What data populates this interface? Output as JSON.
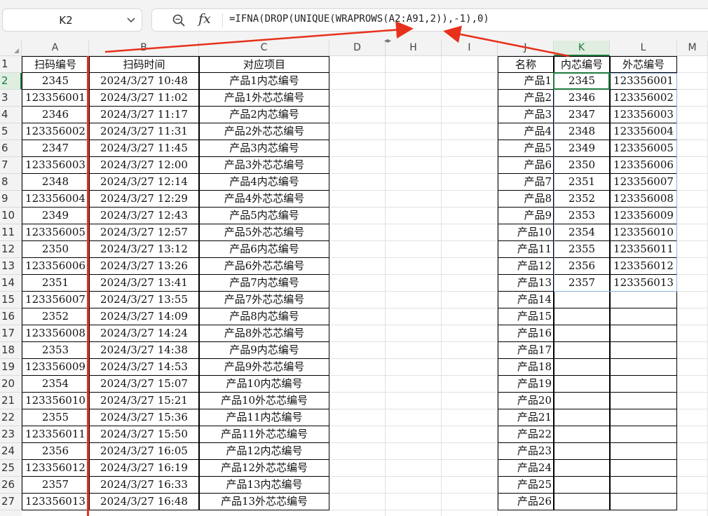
{
  "name_box": {
    "value": "K2"
  },
  "formula_bar": {
    "formula": "=IFNA(DROP(UNIQUE(WRAPROWS(A2:A91,2)),-1),0)",
    "fx_label": "fx"
  },
  "columns": [
    "A",
    "B",
    "C",
    "D",
    "H",
    "I",
    "J",
    "K",
    "L",
    "M"
  ],
  "selected_column": "K",
  "rows": [
    "1",
    "2",
    "3",
    "4",
    "5",
    "6",
    "7",
    "8",
    "9",
    "10",
    "11",
    "12",
    "13",
    "14",
    "15",
    "16",
    "17",
    "18",
    "19",
    "20",
    "21",
    "22",
    "23",
    "24",
    "25",
    "26",
    "27"
  ],
  "selected_row": "2",
  "left_table": {
    "headers": [
      "扫码编号",
      "扫码时间",
      "对应项目"
    ],
    "rows": [
      [
        "2345",
        "2024/3/27  10:48",
        "产品1内芯编号"
      ],
      [
        "123356001",
        "2024/3/27  11:02",
        "产品1外芯芯编号"
      ],
      [
        "2346",
        "2024/3/27  11:17",
        "产品2内芯编号"
      ],
      [
        "123356002",
        "2024/3/27  11:31",
        "产品2外芯芯编号"
      ],
      [
        "2347",
        "2024/3/27  11:45",
        "产品3内芯编号"
      ],
      [
        "123356003",
        "2024/3/27  12:00",
        "产品3外芯芯编号"
      ],
      [
        "2348",
        "2024/3/27  12:14",
        "产品4内芯编号"
      ],
      [
        "123356004",
        "2024/3/27  12:29",
        "产品4外芯芯编号"
      ],
      [
        "2349",
        "2024/3/27  12:43",
        "产品5内芯编号"
      ],
      [
        "123356005",
        "2024/3/27  12:57",
        "产品5外芯芯编号"
      ],
      [
        "2350",
        "2024/3/27  13:12",
        "产品6内芯编号"
      ],
      [
        "123356006",
        "2024/3/27  13:26",
        "产品6外芯芯编号"
      ],
      [
        "2351",
        "2024/3/27  13:41",
        "产品7内芯编号"
      ],
      [
        "123356007",
        "2024/3/27  13:55",
        "产品7外芯芯编号"
      ],
      [
        "2352",
        "2024/3/27  14:09",
        "产品8内芯编号"
      ],
      [
        "123356008",
        "2024/3/27  14:24",
        "产品8外芯芯编号"
      ],
      [
        "2353",
        "2024/3/27  14:38",
        "产品9内芯编号"
      ],
      [
        "123356009",
        "2024/3/27  14:53",
        "产品9外芯芯编号"
      ],
      [
        "2354",
        "2024/3/27  15:07",
        "产品10内芯编号"
      ],
      [
        "123356010",
        "2024/3/27  15:21",
        "产品10外芯芯编号"
      ],
      [
        "2355",
        "2024/3/27  15:36",
        "产品11内芯编号"
      ],
      [
        "123356011",
        "2024/3/27  15:50",
        "产品11外芯芯编号"
      ],
      [
        "2356",
        "2024/3/27  16:05",
        "产品12内芯编号"
      ],
      [
        "123356012",
        "2024/3/27  16:19",
        "产品12外芯芯编号"
      ],
      [
        "2357",
        "2024/3/27  16:33",
        "产品13内芯编号"
      ],
      [
        "123356013",
        "2024/3/27  16:48",
        "产品13外芯芯编号"
      ]
    ]
  },
  "right_table": {
    "headers": [
      "名称",
      "内芯编号",
      "外芯编号"
    ],
    "rows": [
      [
        "产品1",
        "2345",
        "123356001"
      ],
      [
        "产品2",
        "2346",
        "123356002"
      ],
      [
        "产品3",
        "2347",
        "123356003"
      ],
      [
        "产品4",
        "2348",
        "123356004"
      ],
      [
        "产品5",
        "2349",
        "123356005"
      ],
      [
        "产品6",
        "2350",
        "123356006"
      ],
      [
        "产品7",
        "2351",
        "123356007"
      ],
      [
        "产品8",
        "2352",
        "123356008"
      ],
      [
        "产品9",
        "2353",
        "123356009"
      ],
      [
        "产品10",
        "2354",
        "123356010"
      ],
      [
        "产品11",
        "2355",
        "123356011"
      ],
      [
        "产品12",
        "2356",
        "123356012"
      ],
      [
        "产品13",
        "2357",
        "123356013"
      ],
      [
        "产品14",
        "",
        ""
      ],
      [
        "产品15",
        "",
        ""
      ],
      [
        "产品16",
        "",
        ""
      ],
      [
        "产品17",
        "",
        ""
      ],
      [
        "产品18",
        "",
        ""
      ],
      [
        "产品19",
        "",
        ""
      ],
      [
        "产品20",
        "",
        ""
      ],
      [
        "产品21",
        "",
        ""
      ],
      [
        "产品22",
        "",
        ""
      ],
      [
        "产品23",
        "",
        ""
      ],
      [
        "产品24",
        "",
        ""
      ],
      [
        "产品25",
        "",
        ""
      ],
      [
        "产品26",
        "",
        ""
      ]
    ]
  },
  "colors": {
    "accent": "#1e7a3c",
    "annotation": "#e8311c",
    "spill_border": "#8cb1dc"
  },
  "icons": {
    "zoom": "zoom-formula-icon",
    "dropdown": "chevron-down-icon"
  }
}
